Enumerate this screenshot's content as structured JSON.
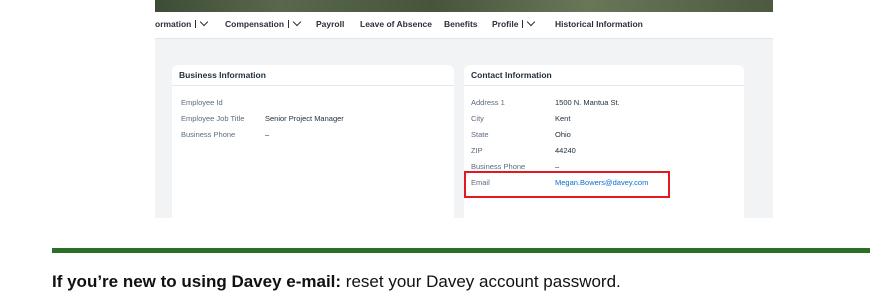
{
  "nav": {
    "items": [
      {
        "label": "ormation",
        "chevron": true,
        "separator": true
      },
      {
        "label": "Compensation",
        "chevron": true,
        "separator": true
      },
      {
        "label": "Payroll",
        "chevron": false
      },
      {
        "label": "Leave of Absence",
        "chevron": false
      },
      {
        "label": "Benefits",
        "chevron": false
      },
      {
        "label": "Profile",
        "chevron": true,
        "separator": true
      },
      {
        "label": "Historical Information",
        "chevron": false
      }
    ]
  },
  "business": {
    "title": "Business Information",
    "fields": [
      {
        "label": "Employee Id",
        "value": ""
      },
      {
        "label": "Employee Job Title",
        "value": "Senior Project Manager"
      },
      {
        "label": "Business Phone",
        "value": "–"
      }
    ]
  },
  "contact": {
    "title": "Contact Information",
    "fields": [
      {
        "label": "Address 1",
        "value": "1500 N. Mantua St."
      },
      {
        "label": "City",
        "value": "Kent"
      },
      {
        "label": "State",
        "value": "Ohio"
      },
      {
        "label": "ZIP",
        "value": "44240"
      },
      {
        "label": "Business Phone",
        "value": "–"
      },
      {
        "label": "Email",
        "value": "Megan.Bowers@davey.com",
        "link": true
      }
    ]
  },
  "footer": {
    "bold": "If you’re new to using Davey e-mail:",
    "rest": " reset your Davey account password."
  },
  "colors": {
    "highlight": "#e11a22",
    "rule": "#2d6e27",
    "link": "#0a6ed1"
  }
}
